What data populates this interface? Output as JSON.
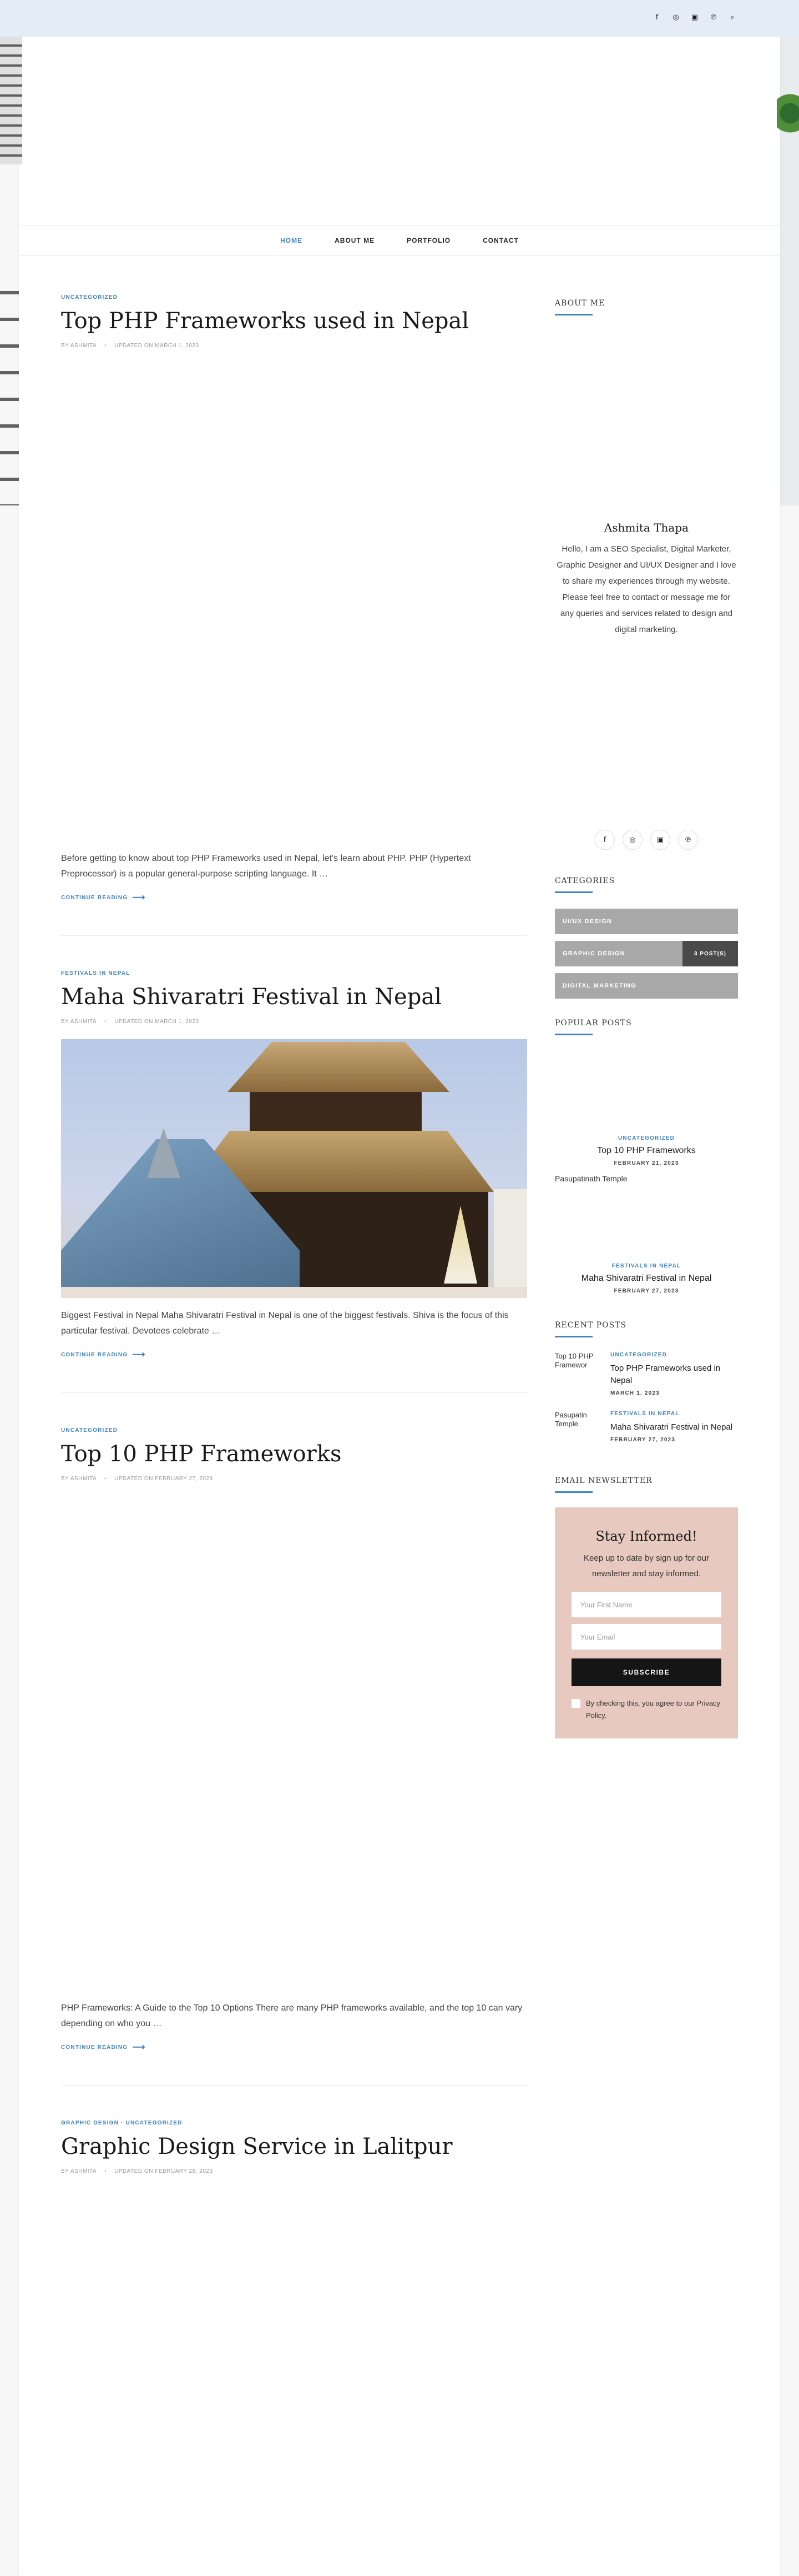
{
  "topbar": {
    "icons": [
      "facebook-icon",
      "instagram-icon",
      "linkedin-icon",
      "pinterest-icon",
      "search-icon"
    ]
  },
  "nav": {
    "items": [
      {
        "label": "HOME",
        "active": true
      },
      {
        "label": "ABOUT ME"
      },
      {
        "label": "PORTFOLIO"
      },
      {
        "label": "CONTACT"
      }
    ]
  },
  "posts": [
    {
      "category": "UNCATEGORIZED",
      "title": "Top PHP Frameworks used in Nepal",
      "author": "BY ASHMITA",
      "updated": "UPDATED ON MARCH 1, 2023",
      "excerpt": "Before getting to know about top PHP Frameworks used in Nepal, let's learn about PHP. PHP (Hypertext Preprocessor) is a popular general-purpose scripting language. It …",
      "more": "CONTINUE READING"
    },
    {
      "category": "FESTIVALS IN NEPAL",
      "title": "Maha Shivaratri Festival in Nepal",
      "author": "BY ASHMITA",
      "updated": "UPDATED ON MARCH 1, 2023",
      "excerpt": "Biggest Festival in Nepal Maha Shivaratri Festival in Nepal is one of the biggest festivals. Shiva is the focus of this particular festival. Devotees celebrate …",
      "more": "CONTINUE READING"
    },
    {
      "category": "UNCATEGORIZED",
      "title": "Top 10 PHP Frameworks",
      "author": "BY ASHMITA",
      "updated": "UPDATED ON FEBRUARY 27, 2023",
      "excerpt": "PHP Frameworks: A Guide to the Top 10 Options There are many PHP frameworks available, and the top 10 can vary depending on who you …",
      "more": "CONTINUE READING"
    },
    {
      "category": "GRAPHIC DESIGN · UNCATEGORIZED",
      "title": "Graphic Design Service in Lalitpur",
      "author": "BY ASHMITA",
      "updated": "UPDATED ON FEBRUARY 28, 2023"
    }
  ],
  "sidebar": {
    "about": {
      "title": "ABOUT ME",
      "name": "Ashmita Thapa",
      "bio": "Hello, I am a SEO Specialist, Digital Marketer, Graphic Designer and UI/UX Designer and I love to share my experiences through my website. Please feel free to contact or message me for any queries and services related to design and digital marketing.",
      "social": [
        "facebook-icon",
        "instagram-icon",
        "linkedin-icon",
        "pinterest-icon"
      ]
    },
    "categories": {
      "title": "CATEGORIES",
      "items": [
        {
          "label": "UI/UX DESIGN"
        },
        {
          "label": "GRAPHIC DESIGN",
          "count": "3 POST(S)"
        },
        {
          "label": "DIGITAL MARKETING"
        }
      ]
    },
    "popular": {
      "title": "POPULAR POSTS",
      "items": [
        {
          "category": "UNCATEGORIZED",
          "title": "Top 10 PHP Frameworks",
          "date": "FEBRUARY 21, 2023"
        },
        {
          "img_alt": "Pasupatinath Temple",
          "category": "FESTIVALS IN NEPAL",
          "title": "Maha Shivaratri Festival in Nepal",
          "date": "FEBRUARY 27, 2023"
        }
      ]
    },
    "recent": {
      "title": "RECENT POSTS",
      "items": [
        {
          "img_alt": "Top 10 PHP Framewor",
          "category": "UNCATEGORIZED",
          "title": "Top PHP Frameworks used in Nepal",
          "date": "MARCH 1, 2023"
        },
        {
          "img_alt": "Pasupatin Temple",
          "category": "FESTIVALS IN NEPAL",
          "title": "Maha Shivaratri Festival in Nepal",
          "date": "FEBRUARY 27, 2023"
        }
      ]
    },
    "newsletter": {
      "title": "EMAIL NEWSLETTER",
      "heading": "Stay Informed!",
      "desc": "Keep up to date by sign up for our newsletter and stay informed.",
      "first_name_placeholder": "Your First Name",
      "email_placeholder": "Your Email",
      "button": "SUBSCRIBE",
      "consent": "By checking this, you agree to our Privacy Policy."
    }
  }
}
